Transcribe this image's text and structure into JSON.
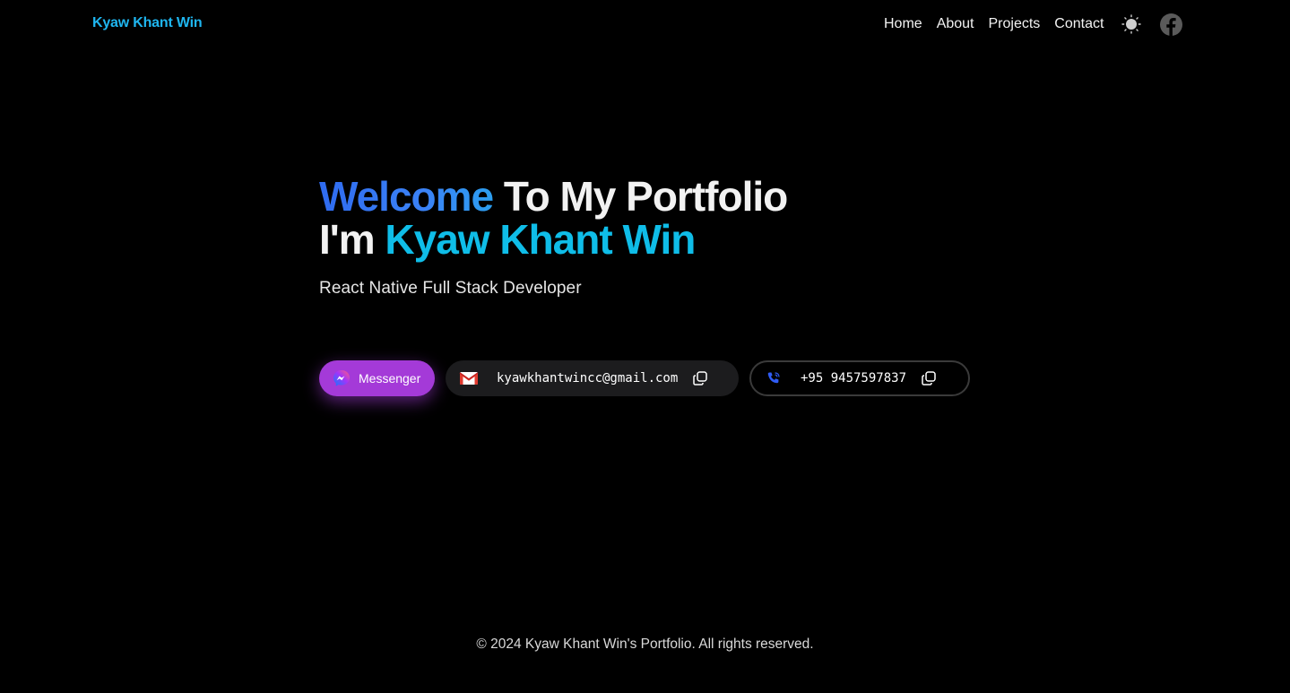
{
  "nav": {
    "brand": "Kyaw Khant Win",
    "links": [
      "Home",
      "About",
      "Projects",
      "Contact"
    ],
    "theme_icon": "sun-icon",
    "social_icon": "facebook-icon"
  },
  "hero": {
    "welcome": "Welcome",
    "title_rest": " To My Portfolio",
    "im": "I'm ",
    "name": "Kyaw Khant Win",
    "subtitle": "React Native Full Stack Developer"
  },
  "contacts": {
    "messenger_label": "Messenger",
    "email": "kyawkhantwincc@gmail.com",
    "phone": "+95 9457597837"
  },
  "footer": {
    "text": "© 2024 Kyaw Khant Win's Portfolio. All rights reserved."
  },
  "colors": {
    "accent": "#0fbde8",
    "welcome": "#2f6bf0",
    "messenger": "#a43ad8"
  }
}
